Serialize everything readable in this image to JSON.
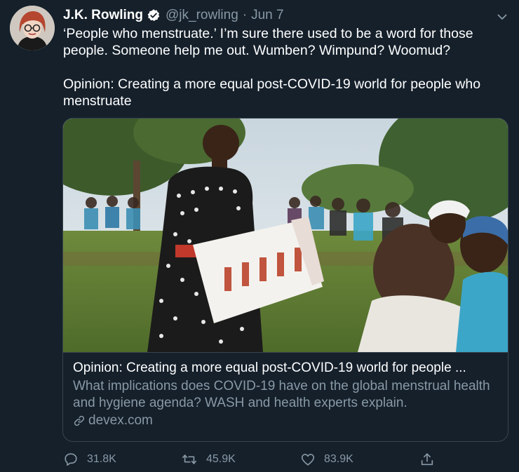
{
  "author": {
    "display_name": "J.K. Rowling",
    "handle": "@jk_rowling",
    "separator": "·",
    "date": "Jun 7",
    "verified": true
  },
  "icons": {
    "verified": "verified-badge-icon",
    "caret": "chevron-down-icon",
    "link": "link-icon",
    "reply": "reply-icon",
    "retweet": "retweet-icon",
    "like": "heart-icon",
    "share": "share-icon"
  },
  "tweet": {
    "paragraphs": [
      "‘People who menstruate.’ I’m sure there used to be a word for those people. Someone help me out. Wumben? Wimpund? Woomud?",
      "Opinion: Creating a more equal post-COVID-19 world for people who menstruate"
    ]
  },
  "card": {
    "title": "Opinion: Creating a more equal post-COVID-19 world for people ...",
    "description": "What implications does COVID-19 have on the global menstrual health and hygiene agenda? WASH and health experts explain.",
    "domain": "devex.com"
  },
  "actions": {
    "replies": "31.8K",
    "retweets": "45.9K",
    "likes": "83.9K"
  },
  "colors": {
    "background": "#15202b",
    "text_primary": "#ffffff",
    "text_secondary": "#8899a6",
    "border": "#38444d",
    "verified_badge": "#ffffff"
  }
}
